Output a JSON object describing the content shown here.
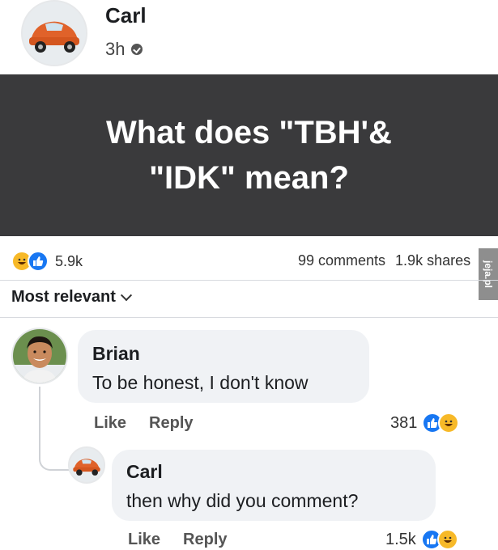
{
  "post": {
    "author": "Carl",
    "time": "3h",
    "banner_text": "What does \"TBH'&\n\"IDK\" mean?",
    "reaction_count": "5.9k",
    "comments_count": "99 comments",
    "shares_count": "1.9k shares",
    "reaction_icons": [
      "haha-icon",
      "like-icon"
    ]
  },
  "sort_label": "Most relevant",
  "comments": [
    {
      "author": "Brian",
      "text": "To be honest, I don't know",
      "like_label": "Like",
      "reply_label": "Reply",
      "reaction_count": "381",
      "reaction_icons": [
        "like-icon",
        "haha-icon"
      ]
    },
    {
      "author": "Carl",
      "text": "then why did you comment?",
      "like_label": "Like",
      "reply_label": "Reply",
      "reaction_count": "1.5k",
      "reaction_icons": [
        "like-icon",
        "haha-icon"
      ]
    }
  ],
  "watermark": "jeja.pl",
  "colors": {
    "banner_bg": "#3a3a3c",
    "like_blue": "#1877f2",
    "haha_yellow": "#f7b928",
    "bubble_bg": "#f0f2f5",
    "car_orange": "#e0622a"
  }
}
